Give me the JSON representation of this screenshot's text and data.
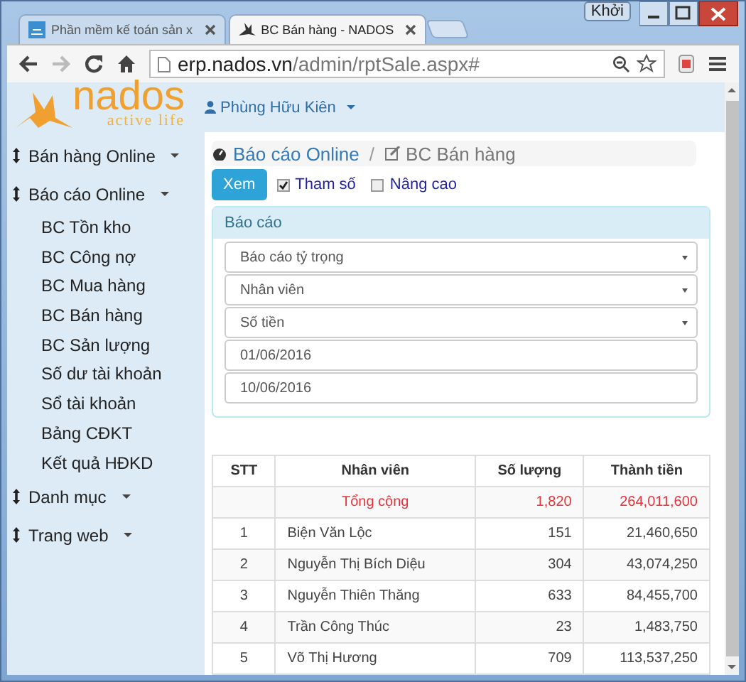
{
  "browser": {
    "tabs": [
      {
        "title": "Phần mềm kế toán sản x",
        "selected": false
      },
      {
        "title": "BC Bán hàng - NADOS",
        "selected": true
      }
    ],
    "window_button": "Khởi",
    "address": {
      "host": "erp.nados.vn",
      "path": "/admin/rptSale.aspx#"
    }
  },
  "header": {
    "logo": {
      "name": "nados",
      "tagline": "active life"
    },
    "user": "Phùng Hữu Kiên"
  },
  "sidebar": {
    "items": [
      {
        "label": "Bán hàng Online"
      },
      {
        "label": "Báo cáo Online",
        "children": [
          {
            "label": "BC Tồn kho"
          },
          {
            "label": "BC Công nợ"
          },
          {
            "label": "BC Mua hàng"
          },
          {
            "label": "BC Bán hàng"
          },
          {
            "label": "BC Sản lượng"
          },
          {
            "label": "Số dư tài khoản"
          },
          {
            "label": "Sổ tài khoản"
          },
          {
            "label": "Bảng CĐKT"
          },
          {
            "label": "Kết quả HĐKD"
          }
        ]
      },
      {
        "label": "Danh mục"
      },
      {
        "label": "Trang web"
      }
    ]
  },
  "breadcrumb": {
    "items": [
      "Báo cáo Online",
      "BC Bán hàng"
    ],
    "separator": "/"
  },
  "actions": {
    "button": "Xem",
    "checkboxes": [
      {
        "label": "Tham số",
        "checked": true
      },
      {
        "label": "Nâng cao",
        "checked": false
      }
    ]
  },
  "panel": {
    "title": "Báo cáo",
    "fields": [
      {
        "kind": "select",
        "value": "Báo cáo tỷ trọng"
      },
      {
        "kind": "select",
        "value": "Nhân viên"
      },
      {
        "kind": "select",
        "value": "Số tiền"
      },
      {
        "kind": "date",
        "value": "01/06/2016"
      },
      {
        "kind": "date",
        "value": "10/06/2016"
      }
    ]
  },
  "table": {
    "columns": [
      "STT",
      "Nhân viên",
      "Số lượng",
      "Thành tiền"
    ],
    "total": {
      "label": "Tổng cộng",
      "quantity": "1,820",
      "amount": "264,011,600"
    },
    "rows": [
      {
        "stt": "1",
        "name": "Biện Văn Lộc",
        "quantity": "151",
        "amount": "21,460,650"
      },
      {
        "stt": "2",
        "name": "Nguyễn Thị Bích Diệu",
        "quantity": "304",
        "amount": "43,074,250"
      },
      {
        "stt": "3",
        "name": "Nguyễn Thiên Thăng",
        "quantity": "633",
        "amount": "84,455,700"
      },
      {
        "stt": "4",
        "name": "Trần Công Thúc",
        "quantity": "23",
        "amount": "1,483,750"
      },
      {
        "stt": "5",
        "name": "Võ Thị Hương",
        "quantity": "709",
        "amount": "113,537,250"
      }
    ]
  }
}
